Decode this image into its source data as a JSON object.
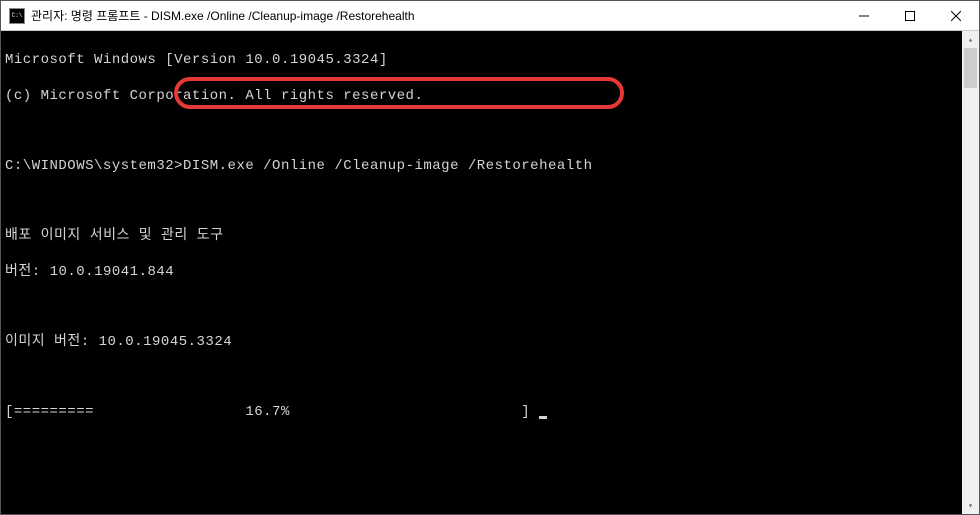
{
  "window": {
    "title": "관리자: 명령 프롬프트 - DISM.exe  /Online /Cleanup-image /Restorehealth"
  },
  "terminal": {
    "line1": "Microsoft Windows [Version 10.0.19045.3324]",
    "line2": "(c) Microsoft Corporation. All rights reserved.",
    "blank1": "",
    "prompt_path": "C:\\WINDOWS\\system32>",
    "command": "DISM.exe /Online /Cleanup-image /Restorehealth",
    "blank2": "",
    "tool_name": "배포 이미지 서비스 및 관리 도구",
    "tool_version": "버전: 10.0.19041.844",
    "blank3": "",
    "image_version": "이미지 버전: 10.0.19045.3324",
    "blank4": "",
    "progress_bar": "[=========                 16.7%                          ] "
  },
  "annotation": {
    "highlight_color": "#e53935"
  }
}
